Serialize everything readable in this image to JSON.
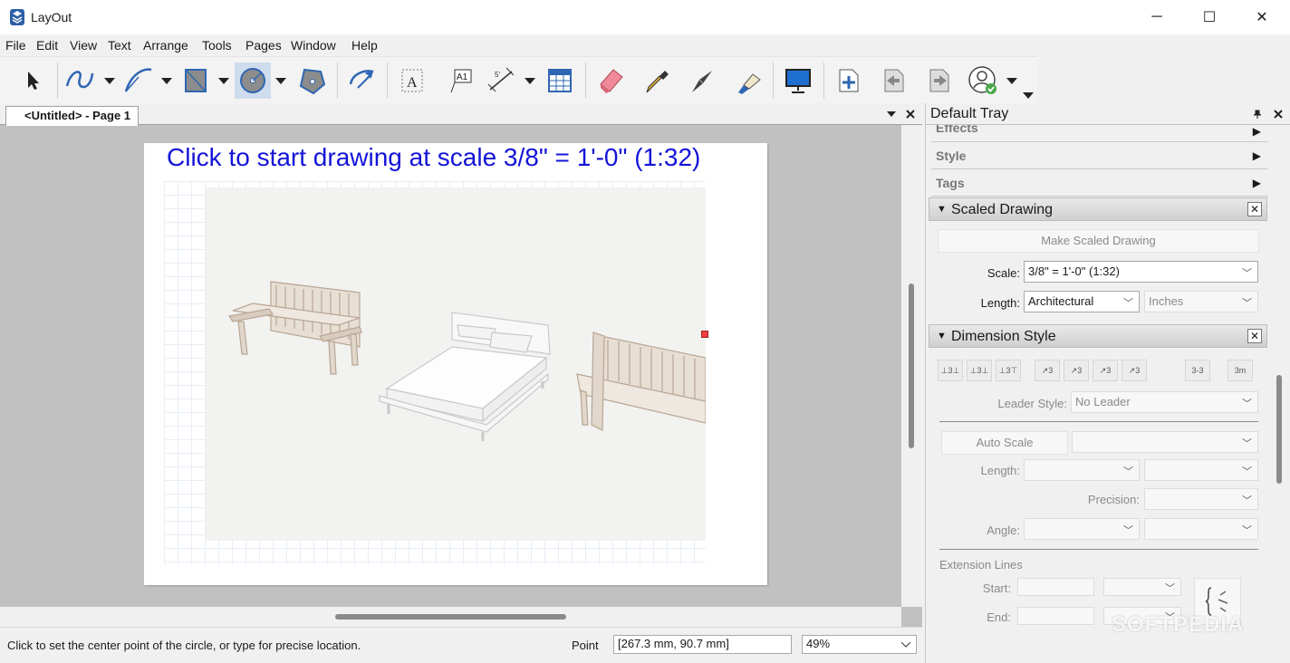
{
  "window": {
    "title": "LayOut",
    "minimize": "─",
    "maximize": "☐",
    "close": "✕"
  },
  "menu": [
    "File",
    "Edit",
    "View",
    "Text",
    "Arrange",
    "Tools",
    "Pages",
    "Window",
    "Help"
  ],
  "toolbar": {
    "tools": [
      "select-icon",
      "freehand-icon",
      "arc-icon",
      "rectangle-icon",
      "circle-icon",
      "polygon-icon",
      "scaled-drawing-icon",
      "text-icon",
      "label-icon",
      "dimension-icon",
      "table-icon",
      "eraser-icon",
      "eyedropper-icon",
      "split-icon",
      "join-icon",
      "presentation-icon",
      "add-page-icon",
      "previous-page-icon",
      "next-page-icon",
      "account-icon"
    ]
  },
  "document": {
    "tab_label": "<Untitled> - Page 1",
    "hint": "Click to start drawing at scale 3/8\" = 1'-0\" (1:32)"
  },
  "status": {
    "message": "Click to set the center point of the circle, or type for precise location.",
    "point_label": "Point",
    "point_value": "[267.3 mm, 90.7 mm]",
    "zoom": "49%"
  },
  "tray": {
    "title": "Default Tray",
    "collapsed_panels": [
      "Effects",
      "Style",
      "Tags"
    ],
    "scaled_drawing": {
      "title": "Scaled Drawing",
      "make_button": "Make Scaled Drawing",
      "scale_label": "Scale:",
      "scale_value": "3/8\" = 1'-0\" (1:32)",
      "length_label": "Length:",
      "length_value": "Architectural",
      "length_unit": "Inches"
    },
    "dimension_style": {
      "title": "Dimension Style",
      "buttons": [
        "⊥3⊥",
        "⊥3⊥",
        "⊥3⊤",
        "↗3",
        "↗3",
        "↗3",
        "↗3",
        "3-3",
        "3m"
      ],
      "leader_label": "Leader Style:",
      "leader_value": "No Leader",
      "auto_scale": "Auto Scale",
      "length_label": "Length:",
      "precision_label": "Precision:",
      "angle_label": "Angle:",
      "extension_title": "Extension Lines",
      "start_label": "Start:",
      "end_label": "End:"
    }
  },
  "watermark": "SOFTPEDIA"
}
